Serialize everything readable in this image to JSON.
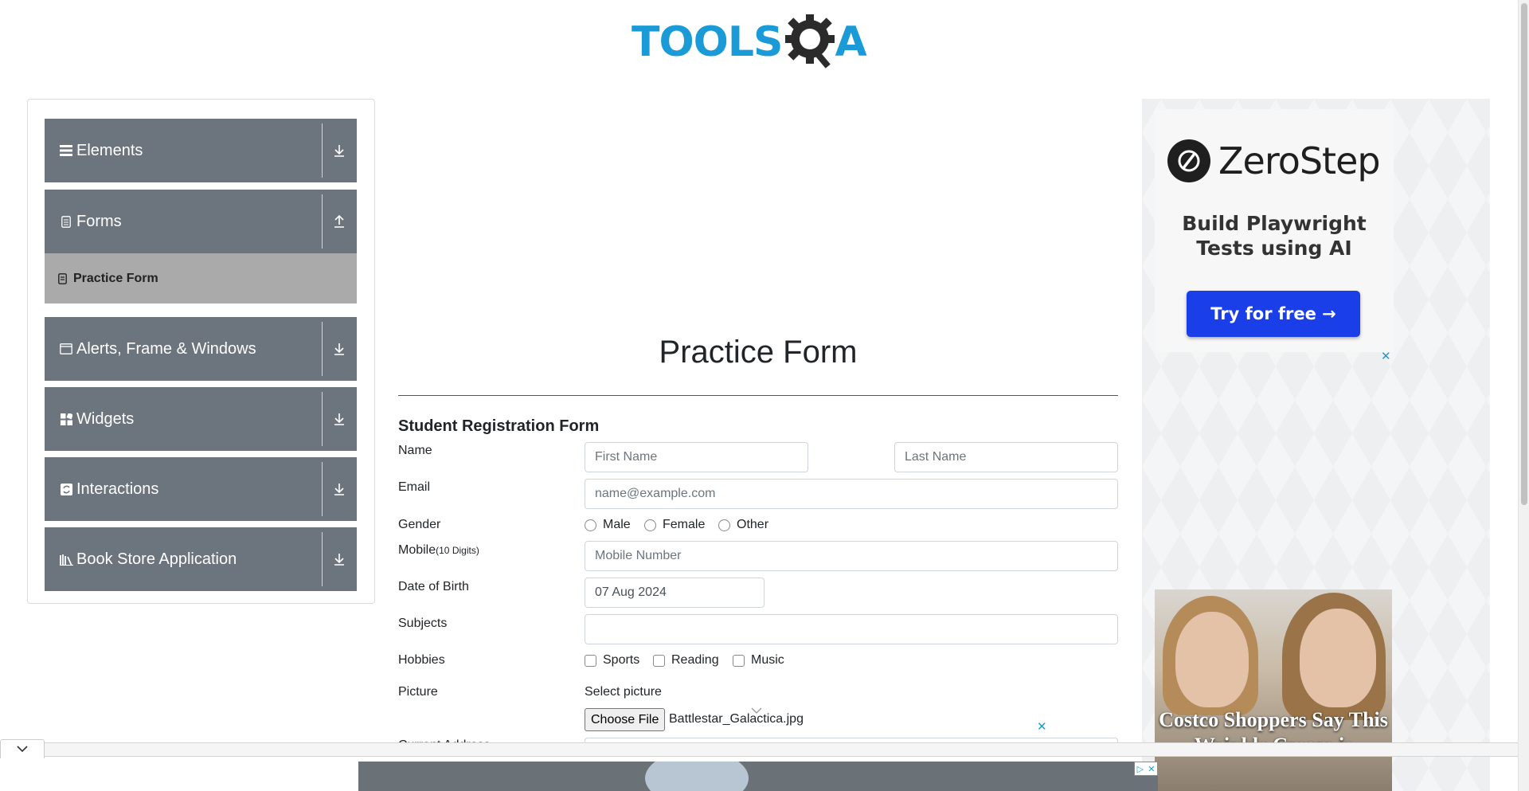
{
  "header": {
    "logo_text_a": "TOOLS",
    "logo_text_b": "QA"
  },
  "sidebar": {
    "groups": [
      {
        "label": "Elements",
        "icon": "hamburger-icon",
        "arrow": "download-icon"
      },
      {
        "label": "Forms",
        "icon": "document-icon",
        "arrow": "upload-icon"
      },
      {
        "label": "Alerts, Frame & Windows",
        "icon": "window-icon",
        "arrow": "download-icon"
      },
      {
        "label": "Widgets",
        "icon": "widgets-icon",
        "arrow": "download-icon"
      },
      {
        "label": "Interactions",
        "icon": "interactions-icon",
        "arrow": "download-icon"
      },
      {
        "label": "Book Store Application",
        "icon": "library-icon",
        "arrow": "download-icon"
      }
    ],
    "active_subitem": {
      "label": "Practice Form",
      "icon": "form-icon"
    },
    "group_color": "#6c757d",
    "subitem_color": "#aaaaaa"
  },
  "main": {
    "title": "Practice Form",
    "form_title": "Student Registration Form",
    "name_label": "Name",
    "first_name_placeholder": "First Name",
    "last_name_placeholder": "Last Name",
    "email_label": "Email",
    "email_placeholder": "name@example.com",
    "gender_label": "Gender",
    "gender_options": [
      "Male",
      "Female",
      "Other"
    ],
    "mobile_label": "Mobile",
    "mobile_hint": "(10 Digits)",
    "mobile_placeholder": "Mobile Number",
    "dob_label": "Date of Birth",
    "dob_value": "07 Aug 2024",
    "subjects_label": "Subjects",
    "hobbies_label": "Hobbies",
    "hobby_options": [
      "Sports",
      "Reading",
      "Music"
    ],
    "picture_label": "Picture",
    "select_picture_label": "Select picture",
    "choose_file_label": "Choose File",
    "file_name": "Battlestar_Galactica.jpg",
    "current_address_label": "Current Address"
  },
  "ads": {
    "zerostep": {
      "name": "ZeroStep",
      "tagline_line1": "Build Playwright",
      "tagline_line2": "Tests using AI",
      "cta": "Try for free →",
      "cta_color": "#1a3fe8"
    },
    "costco": {
      "headline_line1": "Costco Shoppers Say This",
      "headline_line2": "Wrinkle Cream is"
    },
    "close_symbol": "✕",
    "badge_symbols": [
      "▷",
      "✕"
    ]
  }
}
